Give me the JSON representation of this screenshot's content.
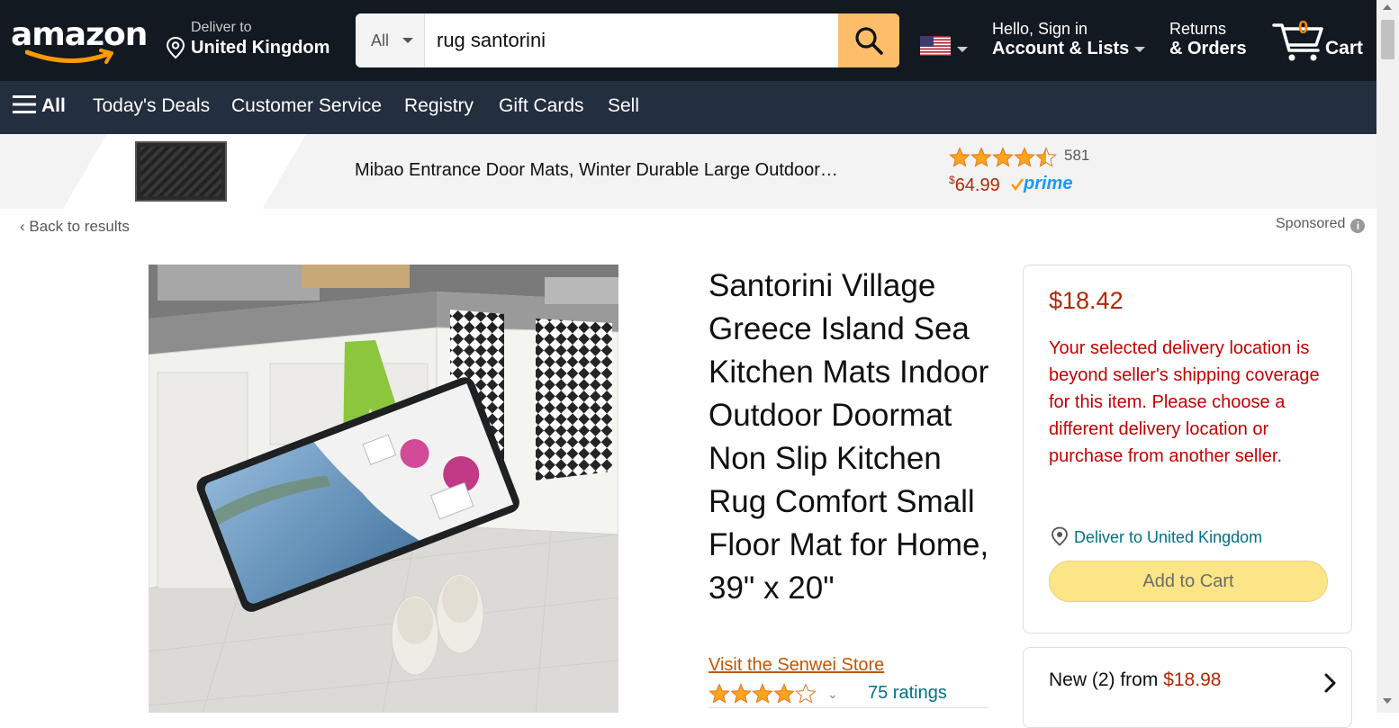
{
  "header": {
    "logo_text": "amazon",
    "deliver_line1": "Deliver to",
    "deliver_line2": "United Kingdom",
    "search_category": "All",
    "search_value": "rug santorini",
    "account_line1": "Hello, Sign in",
    "account_line2": "Account & Lists",
    "returns_line1": "Returns",
    "returns_line2": "& Orders",
    "cart_count": "0",
    "cart_label": "Cart"
  },
  "subnav": {
    "all": "All",
    "items": [
      "Today's Deals",
      "Customer Service",
      "Registry",
      "Gift Cards",
      "Sell"
    ]
  },
  "banner": {
    "title": "Mibao Entrance Door Mats, Winter Durable Large Outdoor…",
    "rating_count": "581",
    "rating_stars": 4.5,
    "price_symbol": "$",
    "price_value": "64.99",
    "prime": "prime"
  },
  "nav": {
    "back": "Back to results",
    "sponsored": "Sponsored"
  },
  "product": {
    "title": "Santorini Village Greece Island Sea Kitchen Mats Indoor Outdoor Doormat Non Slip Kitchen Rug Comfort Small Floor Mat for Home, 39\" x 20\"",
    "store_link": "Visit the Senwei Store",
    "rating_stars": 4,
    "ratings_text": "75 ratings"
  },
  "buybox": {
    "price": "$18.42",
    "warning": "Your selected delivery location is beyond seller's shipping coverage for this item. Please choose a different delivery location or purchase from another seller.",
    "deliver_to": "Deliver to United Kingdom",
    "add_to_cart": "Add to Cart"
  },
  "other_sellers": {
    "label": "New (2) from",
    "price": "$18.98"
  },
  "colors": {
    "nav_bg": "#131921",
    "subnav_bg": "#232f3e",
    "search_button": "#febd69",
    "price_red": "#b12704",
    "link_teal": "#007185",
    "store_orange": "#c45500",
    "add_to_cart_yellow": "#fce586"
  }
}
